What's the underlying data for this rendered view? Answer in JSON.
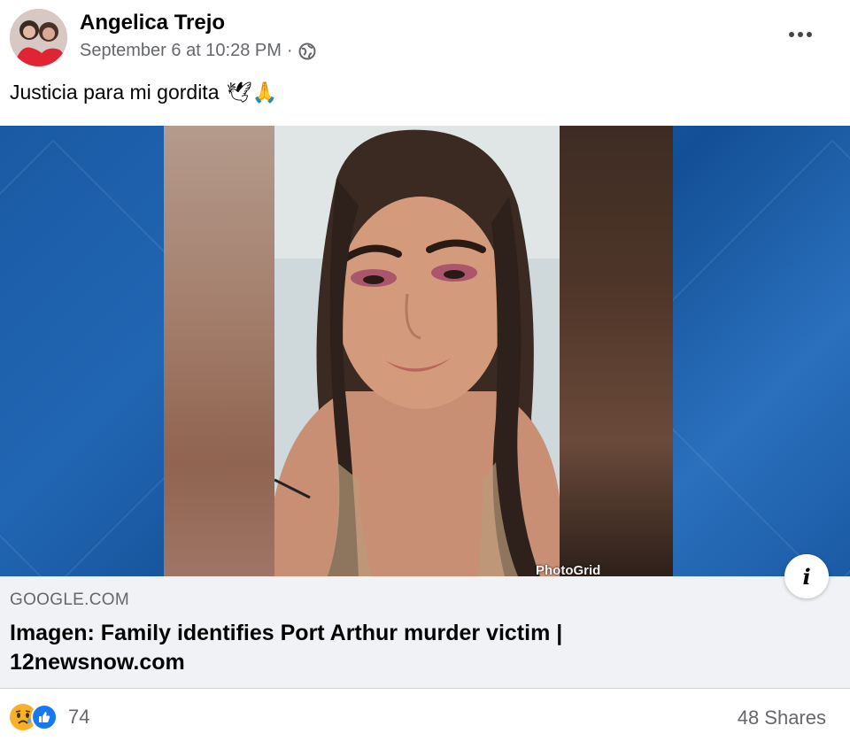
{
  "post": {
    "author": "Angelica Trejo",
    "timestamp": "September 6 at 10:28 PM",
    "separator": "·",
    "privacy_icon": "globe-icon",
    "caption": "Justicia para mi gordita",
    "caption_emojis": "🕊🙏"
  },
  "media": {
    "watermark": "PhotoGrid"
  },
  "link": {
    "domain": "GOOGLE.COM",
    "title": "Imagen: Family identifies Port Arthur murder victim | 12newsnow.com"
  },
  "footer": {
    "reaction_count": "74",
    "shares": "48 Shares"
  },
  "colors": {
    "brand_blue": "#1877f2",
    "link_bg": "#f0f2f5",
    "secondary_text": "#65676b"
  }
}
